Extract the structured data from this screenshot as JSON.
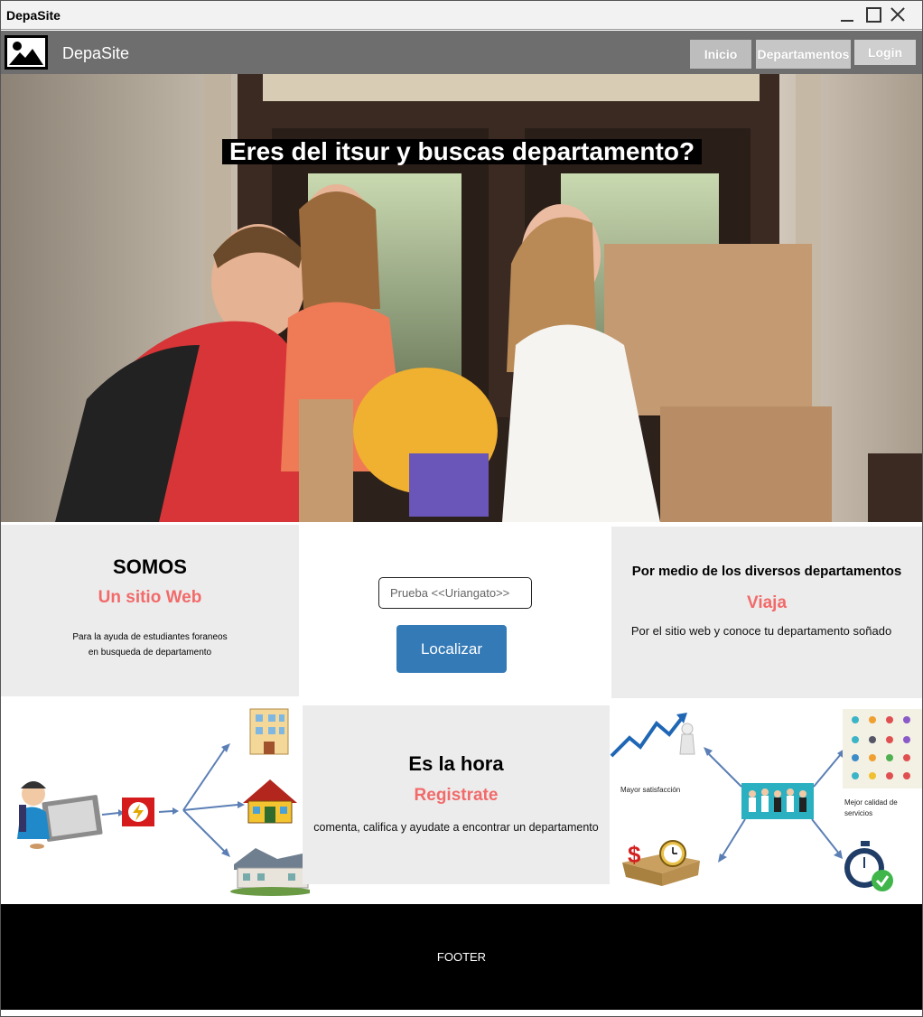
{
  "window": {
    "title": "DepaSite"
  },
  "navbar": {
    "brand": "DepaSite",
    "items": [
      {
        "label": "Inicio"
      },
      {
        "label": "Departamentos"
      },
      {
        "label": "Login"
      }
    ]
  },
  "hero": {
    "headline": "Eres del itsur y buscas departamento?"
  },
  "somos": {
    "heading": "SOMOS",
    "subheading": "Un sitio Web",
    "text_line1": "Para la ayuda de estudiantes foraneos",
    "text_line2": "en busqueda de departamento"
  },
  "search": {
    "placeholder": "Prueba <<Uriangato>>",
    "button_label": "Localizar"
  },
  "viaja": {
    "heading": "Por medio de los diversos departamentos",
    "subheading": "Viaja",
    "text": "Por el sitio web y conoce tu departamento soñado"
  },
  "registrate": {
    "heading": "Es la hora",
    "subheading": "Registrate",
    "text": "comenta, califica y ayudate a encontrar un departamento"
  },
  "benefits_diagram": {
    "label_satisfaction": "Mayor satisfacción",
    "label_services_1": "Mejor calidad de",
    "label_services_2": "servicios"
  },
  "footer": {
    "text": "FOOTER"
  },
  "colors": {
    "accent": "#f26a6a",
    "button": "#337ab7",
    "navbar": "#6e6e6e",
    "panel": "#ececec"
  }
}
